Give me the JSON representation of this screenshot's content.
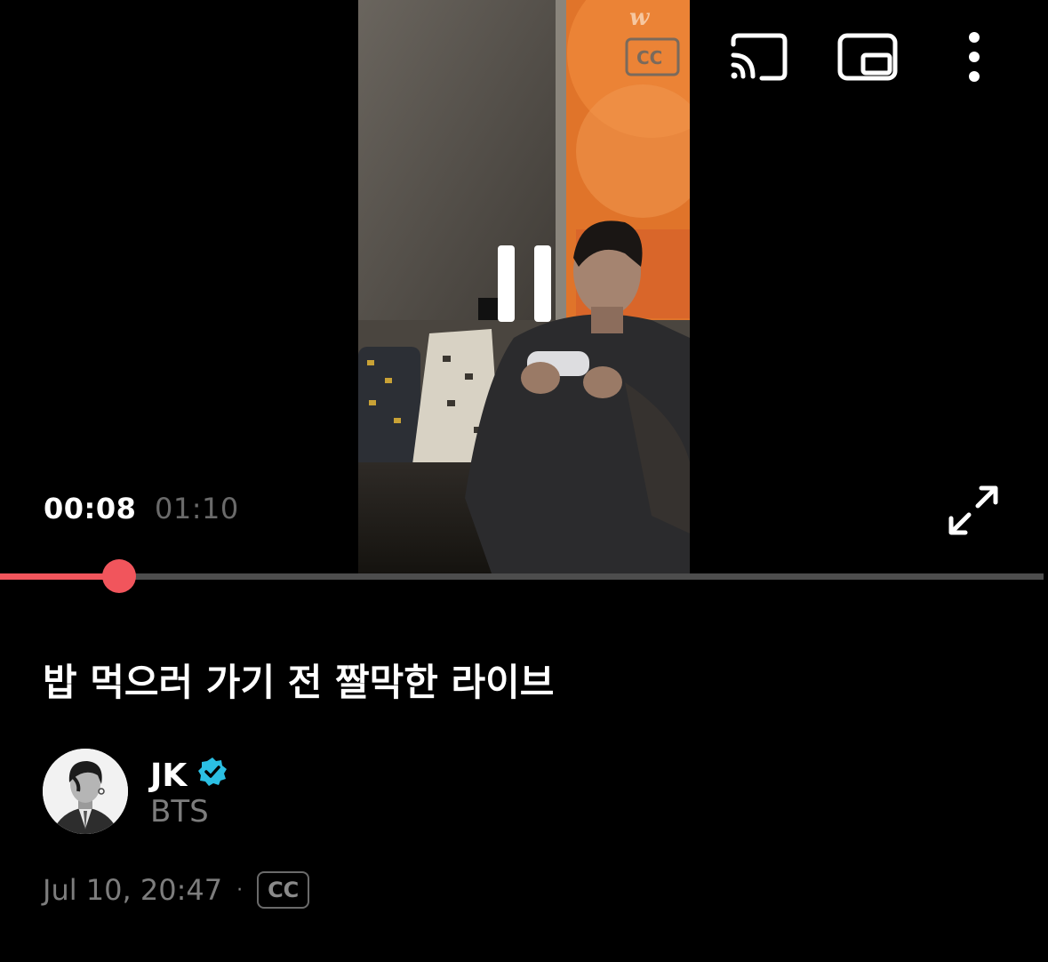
{
  "player": {
    "time_current": "00:08",
    "time_total": "01:10",
    "progress_fraction": 0.114,
    "accent_color": "#f1555c",
    "icons": {
      "cast": "cast-icon",
      "pip": "picture-in-picture-icon",
      "more": "more-vertical-icon",
      "pause": "pause-icon",
      "fullscreen": "fullscreen-icon"
    }
  },
  "video": {
    "title": "밥 먹으러 가기 전 짤막한 라이브"
  },
  "channel": {
    "name": "JK",
    "subtitle": "BTS",
    "verified_color": "#2bbfe3"
  },
  "meta": {
    "date": "Jul 10, 20:47",
    "separator": "·",
    "cc_label": "CC"
  }
}
